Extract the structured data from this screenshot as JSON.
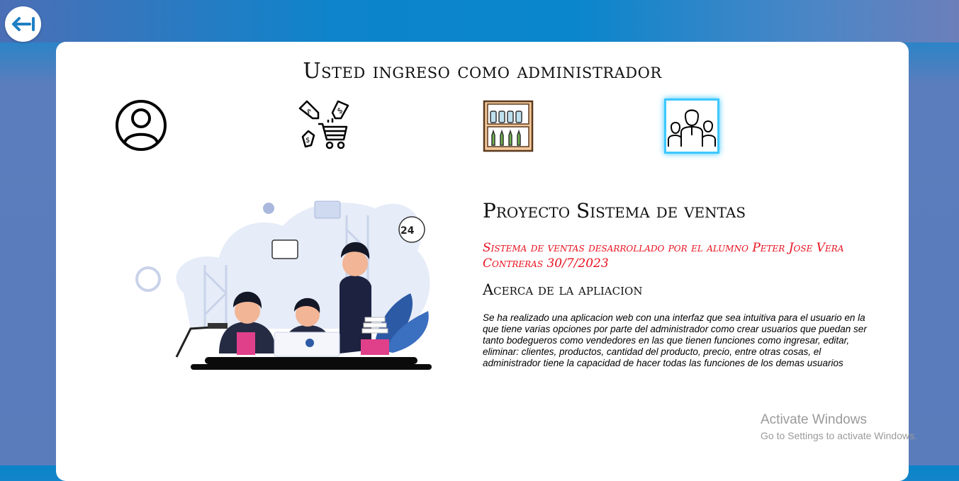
{
  "header": {
    "back_button_icon": "arrow-left-to-bar-icon"
  },
  "main": {
    "title": "Usted ingreso como administrador",
    "nav": [
      {
        "name": "usuarios",
        "icon": "user-circle-icon"
      },
      {
        "name": "ventas",
        "icon": "price-tags-cart-icon"
      },
      {
        "name": "productos",
        "icon": "store-shelf-icon"
      },
      {
        "name": "clientes",
        "icon": "people-group-icon",
        "active": true
      }
    ],
    "illustration_icon": "office-team-illustration"
  },
  "about": {
    "project_title": "Proyecto Sistema de ventas",
    "author": "Sistema de ventas desarrollado por el alumno Peter Jose Vera Contreras 30/7/2023",
    "about_title": "Acerca de la apliacion",
    "description": "Se ha realizado una aplicacion web con una interfaz que sea intuitiva para el usuario en la que tiene varias opciones por parte del administrador como crear usuarios que puedan ser tanto bodegueros como vendedores en las que tienen funciones como ingresar, editar, eliminar: clientes, productos, cantidad del producto, precio, entre otras cosas, el administrador tiene la capacidad de hacer todas las funciones de los demas usuarios"
  },
  "watermark": {
    "line1": "Activate Windows",
    "line2": "Go to Settings to activate Windows."
  },
  "colors": {
    "accent": "#0a84c9",
    "author_red": "#e8101e",
    "active_glow": "#3cc8ff"
  }
}
